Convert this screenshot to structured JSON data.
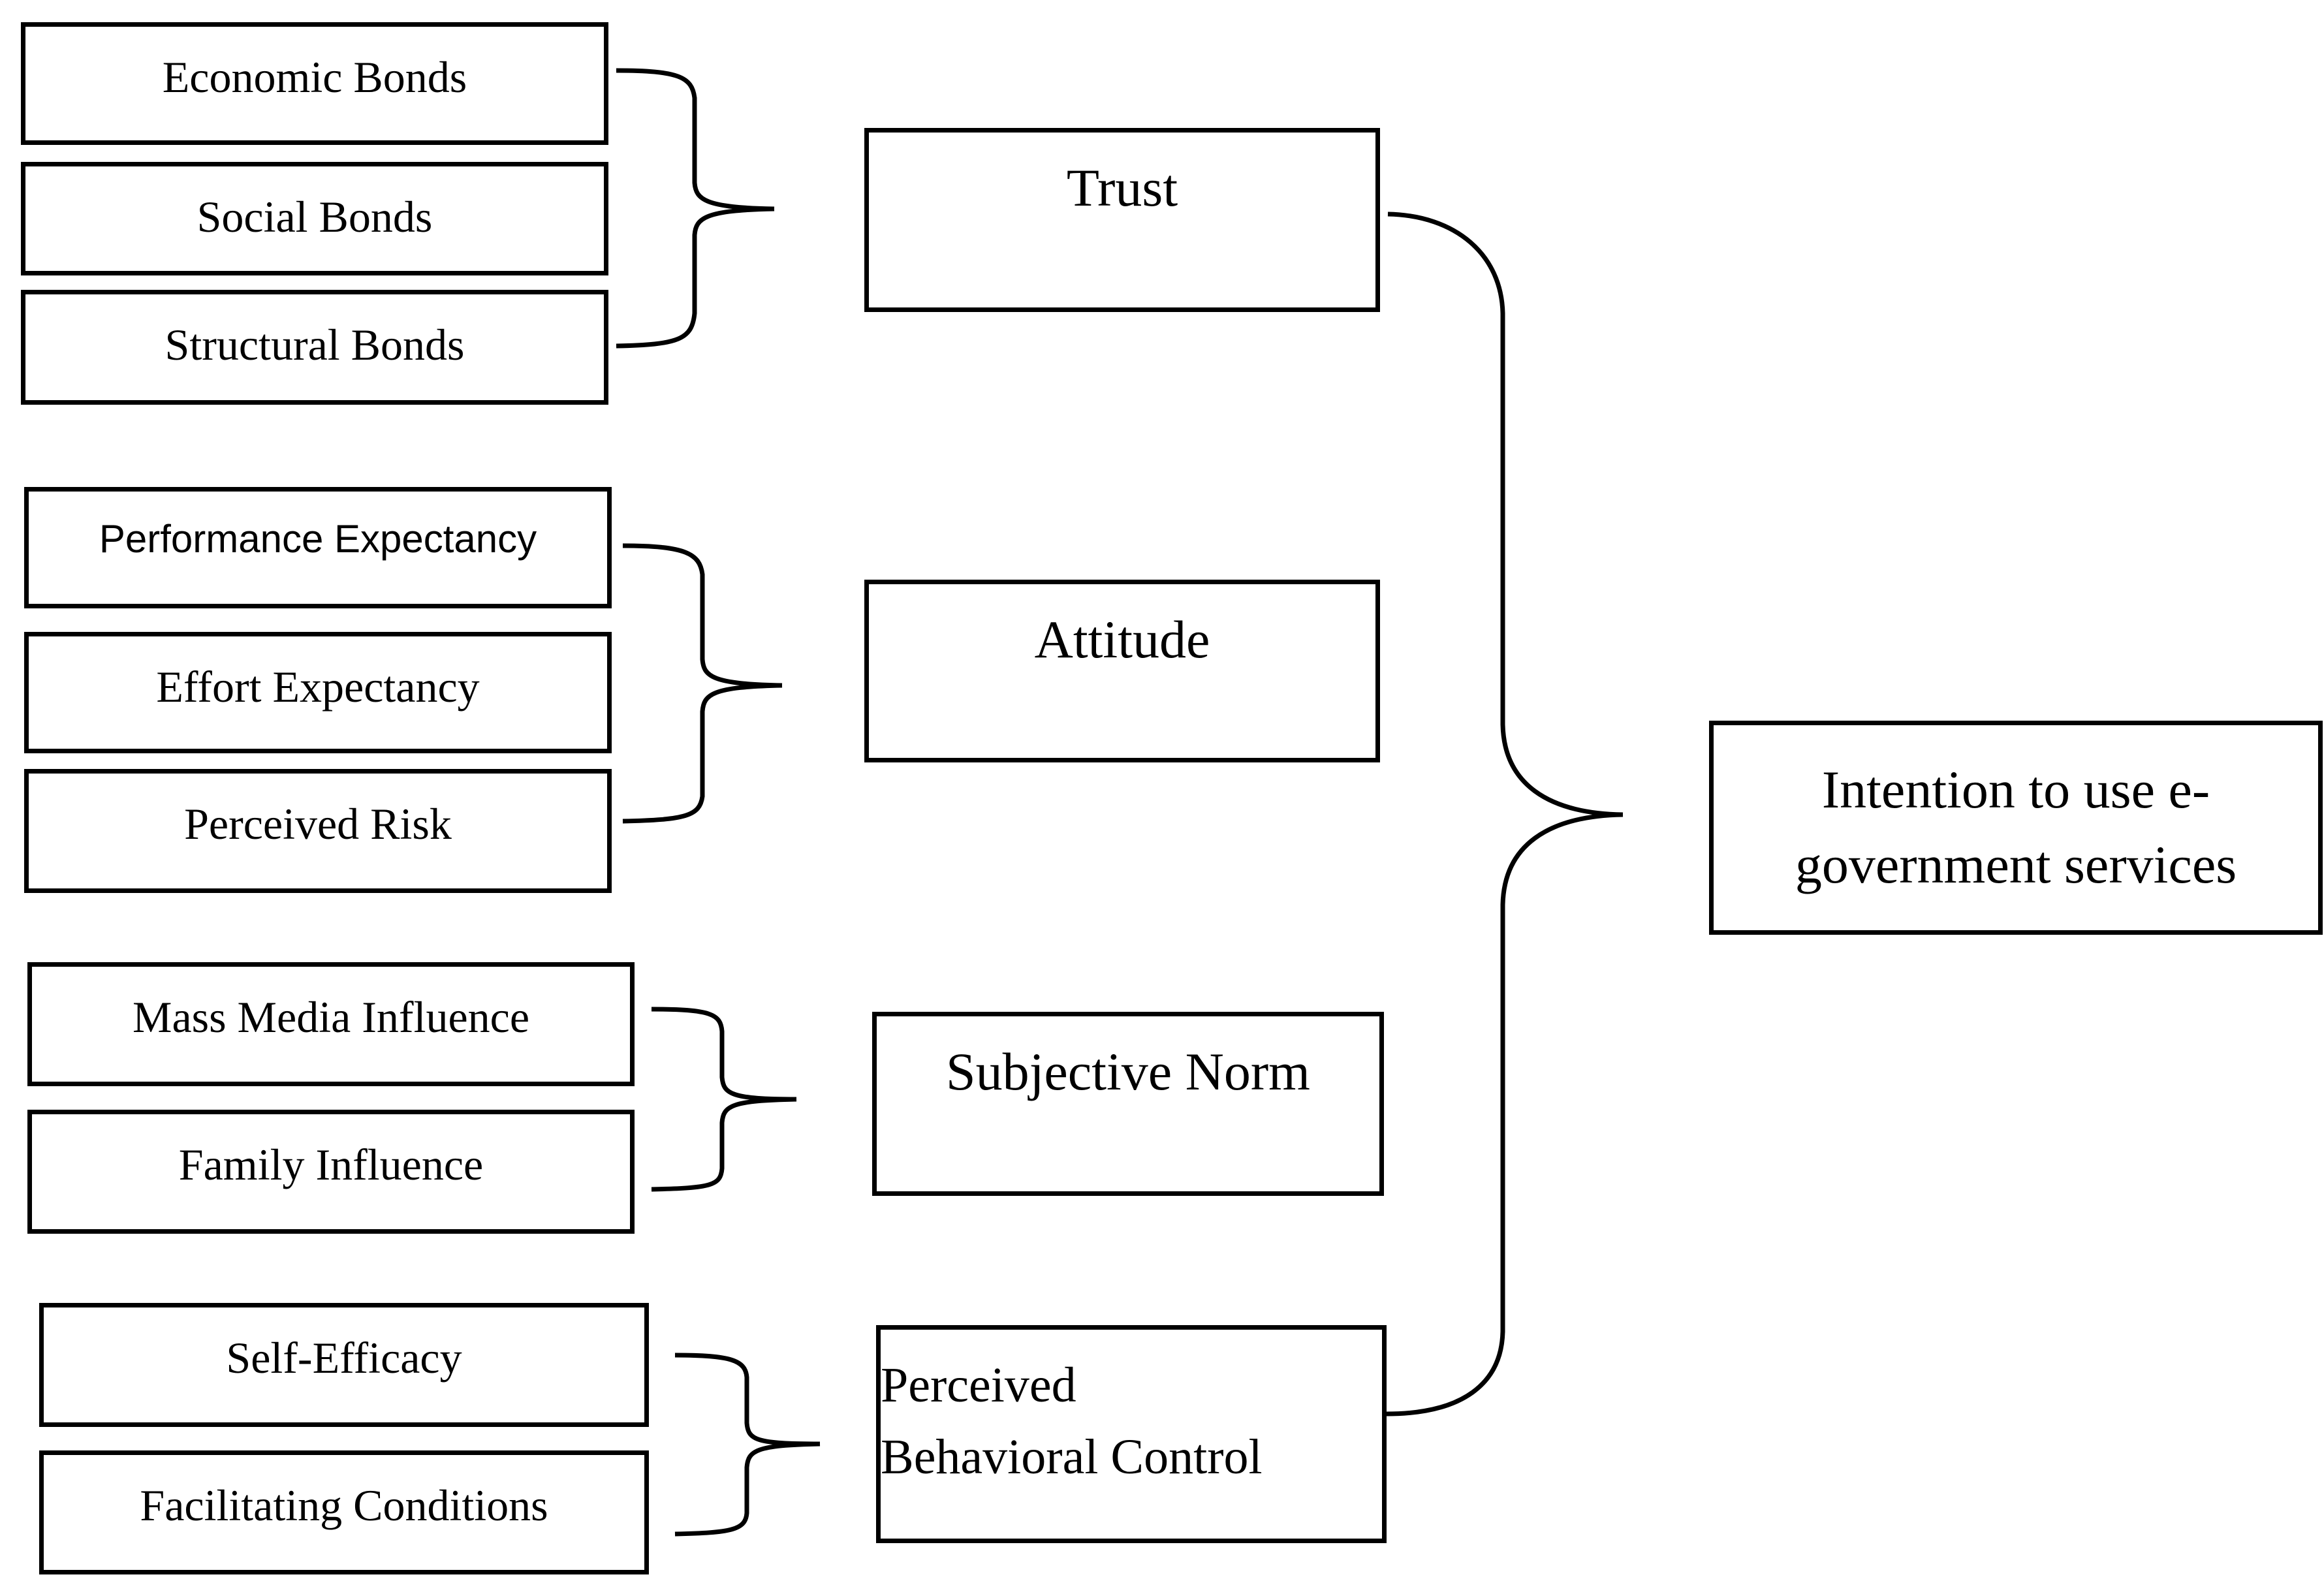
{
  "diagram": {
    "groups": [
      {
        "construct": "Trust",
        "factors": [
          "Economic Bonds",
          "Social Bonds",
          "Structural Bonds"
        ]
      },
      {
        "construct": "Attitude",
        "factors": [
          "Performance Expectancy",
          "Effort Expectancy",
          "Perceived Risk"
        ]
      },
      {
        "construct": "Subjective Norm",
        "factors": [
          "Mass Media Influence",
          "Family Influence"
        ]
      },
      {
        "construct_line1": "Perceived",
        "construct_line2": "Behavioral Control",
        "factors": [
          "Self-Efficacy",
          "Facilitating Conditions"
        ]
      }
    ],
    "outcome": {
      "line1": "Intention to use e-",
      "line2": "government services"
    }
  }
}
